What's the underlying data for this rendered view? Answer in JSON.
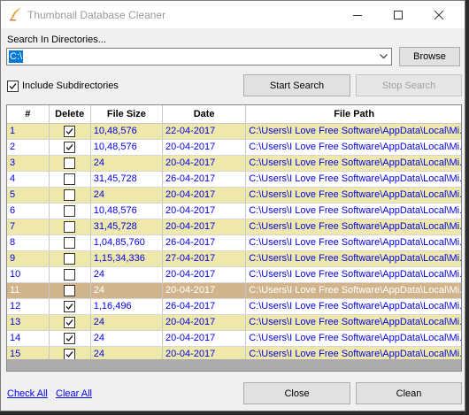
{
  "window": {
    "title": "Thumbnail Database Cleaner"
  },
  "search": {
    "label": "Search In Directories...",
    "directory_value": "C:\\",
    "browse_label": "Browse",
    "include_subdirectories_label": "Include Subdirectories",
    "include_subdirectories_checked": true,
    "start_label": "Start Search",
    "stop_label": "Stop Search"
  },
  "table": {
    "columns": [
      "#",
      "Delete",
      "File Size",
      "Date",
      "File Path"
    ],
    "rows": [
      {
        "num": "1",
        "del": true,
        "size": "10,48,576",
        "date": "22-04-2017",
        "path": "C:\\Users\\I Love Free Software\\AppData\\Local\\Mi..."
      },
      {
        "num": "2",
        "del": true,
        "size": "10,48,576",
        "date": "20-04-2017",
        "path": "C:\\Users\\I Love Free Software\\AppData\\Local\\Mi..."
      },
      {
        "num": "3",
        "del": false,
        "size": "24",
        "date": "20-04-2017",
        "path": "C:\\Users\\I Love Free Software\\AppData\\Local\\Mi..."
      },
      {
        "num": "4",
        "del": false,
        "size": "31,45,728",
        "date": "26-04-2017",
        "path": "C:\\Users\\I Love Free Software\\AppData\\Local\\Mi..."
      },
      {
        "num": "5",
        "del": false,
        "size": "24",
        "date": "20-04-2017",
        "path": "C:\\Users\\I Love Free Software\\AppData\\Local\\Mi..."
      },
      {
        "num": "6",
        "del": false,
        "size": "10,48,576",
        "date": "20-04-2017",
        "path": "C:\\Users\\I Love Free Software\\AppData\\Local\\Mi..."
      },
      {
        "num": "7",
        "del": false,
        "size": "31,45,728",
        "date": "20-04-2017",
        "path": "C:\\Users\\I Love Free Software\\AppData\\Local\\Mi..."
      },
      {
        "num": "8",
        "del": false,
        "size": "1,04,85,760",
        "date": "26-04-2017",
        "path": "C:\\Users\\I Love Free Software\\AppData\\Local\\Mi..."
      },
      {
        "num": "9",
        "del": false,
        "size": "1,15,34,336",
        "date": "27-04-2017",
        "path": "C:\\Users\\I Love Free Software\\AppData\\Local\\Mi..."
      },
      {
        "num": "10",
        "del": false,
        "size": "24",
        "date": "20-04-2017",
        "path": "C:\\Users\\I Love Free Software\\AppData\\Local\\Mi..."
      },
      {
        "num": "11",
        "del": false,
        "size": "24",
        "date": "20-04-2017",
        "path": "C:\\Users\\I Love Free Software\\AppData\\Local\\Mi...",
        "selected": true
      },
      {
        "num": "12",
        "del": true,
        "size": "1,16,496",
        "date": "26-04-2017",
        "path": "C:\\Users\\I Love Free Software\\AppData\\Local\\Mi..."
      },
      {
        "num": "13",
        "del": true,
        "size": "24",
        "date": "20-04-2017",
        "path": "C:\\Users\\I Love Free Software\\AppData\\Local\\Mi..."
      },
      {
        "num": "14",
        "del": true,
        "size": "24",
        "date": "20-04-2017",
        "path": "C:\\Users\\I Love Free Software\\AppData\\Local\\Mi..."
      },
      {
        "num": "15",
        "del": true,
        "size": "24",
        "date": "20-04-2017",
        "path": "C:\\Users\\I Love Free Software\\AppData\\Local\\Mi..."
      }
    ]
  },
  "footer": {
    "check_all_label": "Check All",
    "clear_all_label": "Clear All",
    "close_label": "Close",
    "clean_label": "Clean"
  },
  "colors": {
    "row_alt": "#eee8aa",
    "row_selected": "#d2b48c",
    "link": "#0000ee",
    "selection_blue": "#0078d7"
  }
}
